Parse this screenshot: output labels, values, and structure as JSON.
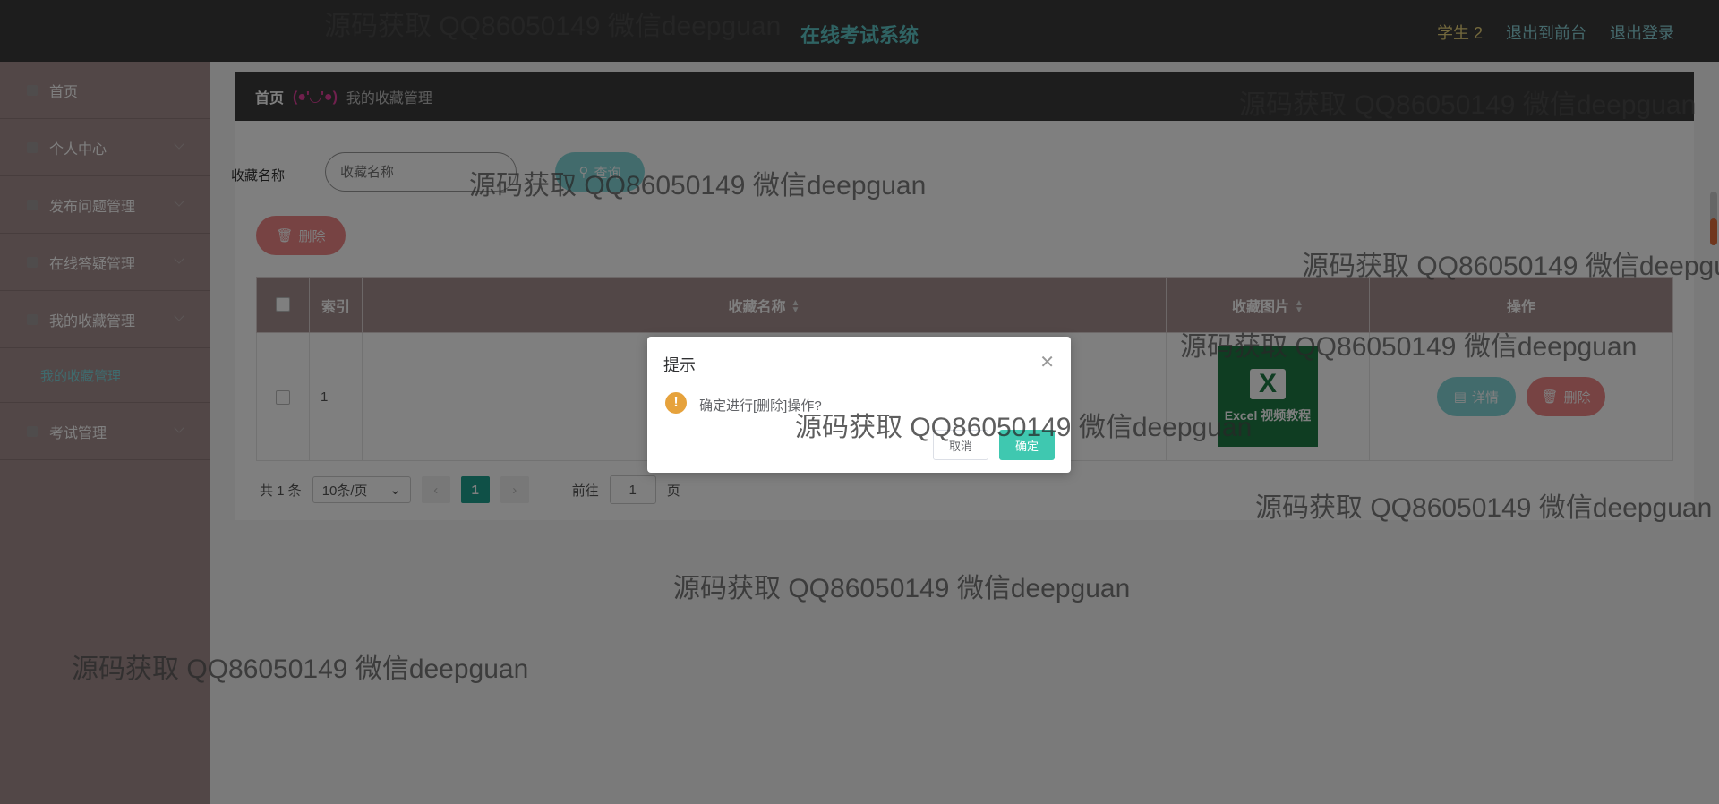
{
  "header": {
    "title": "在线考试系统",
    "user": "学生 2",
    "links": [
      "退出到前台",
      "退出登录"
    ]
  },
  "sidebar": {
    "items": [
      {
        "label": "首页"
      },
      {
        "label": "个人中心"
      },
      {
        "label": "发布问题管理"
      },
      {
        "label": "在线答疑管理"
      },
      {
        "label": "我的收藏管理"
      },
      {
        "label": "我的收藏管理",
        "sub": true
      },
      {
        "label": "考试管理"
      }
    ]
  },
  "breadcrumb": {
    "home": "首页",
    "face": "(●'◡'●)",
    "current": "我的收藏管理"
  },
  "search": {
    "label": "收藏名称",
    "placeholder": "收藏名称",
    "button": "查询"
  },
  "toolbar": {
    "delete_label": "删除"
  },
  "table": {
    "headers": [
      "索引",
      "收藏名称",
      "收藏图片",
      "操作"
    ],
    "rows": [
      {
        "index": "1",
        "name": "",
        "image_caption": "Excel 视频教程",
        "detail_label": "详情",
        "delete_label": "删除"
      }
    ]
  },
  "pagination": {
    "total": "共 1 条",
    "page_size": "10条/页",
    "current_page": "1",
    "goto_label": "前往",
    "goto_value": "1",
    "page_suffix": "页"
  },
  "dialog": {
    "title": "提示",
    "message": "确定进行[删除]操作?",
    "cancel": "取消",
    "confirm": "确定"
  },
  "watermark": "源码获取 QQ86050149 微信deepguan"
}
